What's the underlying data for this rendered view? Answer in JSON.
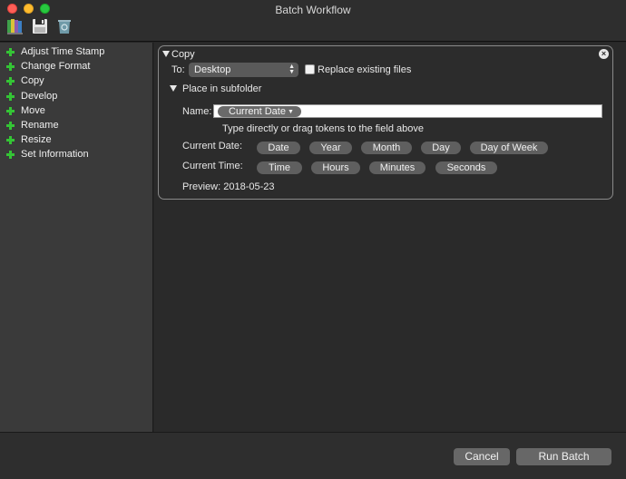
{
  "window": {
    "title": "Batch Workflow"
  },
  "toolbar": {
    "icons": [
      "library-icon",
      "save-icon",
      "trash-icon"
    ]
  },
  "sidebar": {
    "items": [
      {
        "label": "Adjust Time Stamp"
      },
      {
        "label": "Change Format"
      },
      {
        "label": "Copy"
      },
      {
        "label": "Develop"
      },
      {
        "label": "Move"
      },
      {
        "label": "Rename"
      },
      {
        "label": "Resize"
      },
      {
        "label": "Set Information"
      }
    ]
  },
  "copy_panel": {
    "title": "Copy",
    "to_label": "To:",
    "to_value": "Desktop",
    "replace_label": "Replace existing files",
    "subfolder_label": "Place in subfolder",
    "name_label": "Name:",
    "name_token": "Current Date",
    "hint": "Type directly or drag tokens to the field above",
    "current_date_label": "Current Date:",
    "date_tokens": [
      "Date",
      "Year",
      "Month",
      "Day",
      "Day of Week"
    ],
    "current_time_label": "Current Time:",
    "time_tokens": [
      "Time",
      "Hours",
      "Minutes",
      "Seconds"
    ],
    "preview": "Preview: 2018-05-23"
  },
  "buttons": {
    "cancel": "Cancel",
    "run": "Run Batch"
  },
  "colors": {
    "accent_plus": "#34c435",
    "background": "#262626",
    "sidebar": "#3a3a3a"
  }
}
